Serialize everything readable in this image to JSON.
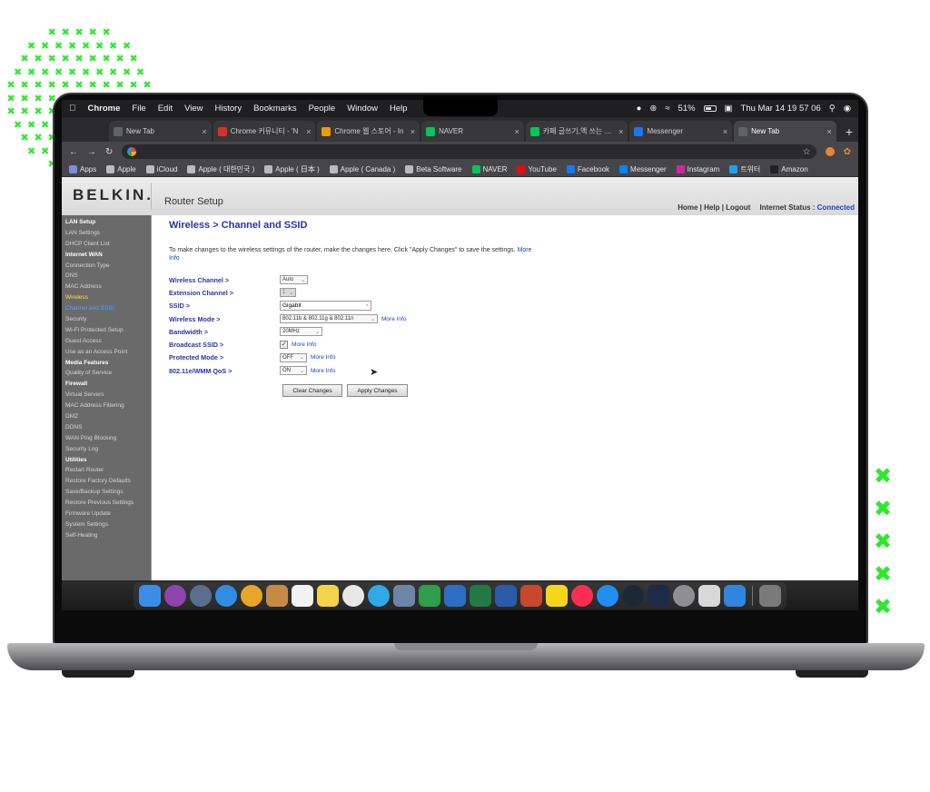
{
  "menubar": {
    "items": [
      "Chrome",
      "File",
      "Edit",
      "View",
      "History",
      "Bookmarks",
      "People",
      "Window",
      "Help"
    ],
    "battery": "51%",
    "datetime": "Thu Mar 14  19 57 06"
  },
  "tabs": [
    {
      "label": "New Tab",
      "color": "#5f6368",
      "active": false
    },
    {
      "label": "Chrome 커뮤니티 - 'N",
      "color": "#d93025",
      "active": false
    },
    {
      "label": "Chrome 웹 스토어 - In",
      "color": "#f29900",
      "active": false
    },
    {
      "label": "NAVER",
      "color": "#03c75a",
      "active": false
    },
    {
      "label": "카페 글쓰기,액 쓰는 사람",
      "color": "#03c75a",
      "active": false
    },
    {
      "label": "Messenger",
      "color": "#1877f2",
      "active": false
    },
    {
      "label": "New Tab",
      "color": "#5f6368",
      "active": true
    }
  ],
  "bookmarks": [
    {
      "label": "Apps",
      "color": "#7b8cde"
    },
    {
      "label": "Apple",
      "color": "#bbbbbb"
    },
    {
      "label": "iCloud",
      "color": "#bbbbbb"
    },
    {
      "label": "Apple ( 대한민국 )",
      "color": "#bbbbbb"
    },
    {
      "label": "Apple ( 日本 )",
      "color": "#bbbbbb"
    },
    {
      "label": "Apple ( Canada )",
      "color": "#bbbbbb"
    },
    {
      "label": "Beta Software",
      "color": "#bbbbbb"
    },
    {
      "label": "NAVER",
      "color": "#03c75a"
    },
    {
      "label": "YouTube",
      "color": "#ff0000"
    },
    {
      "label": "Facebook",
      "color": "#1877f2"
    },
    {
      "label": "Messenger",
      "color": "#0084ff"
    },
    {
      "label": "Instagram",
      "color": "#d6249f"
    },
    {
      "label": "트위터",
      "color": "#1da1f2"
    },
    {
      "label": "Amazon",
      "color": "#222222"
    }
  ],
  "router": {
    "brand": "BELKIN.",
    "setup": "Router Setup",
    "nav": {
      "home": "Home",
      "help": "Help",
      "logout": "Logout",
      "status_label": "Internet Status :",
      "status_value": "Connected"
    },
    "sidebar": [
      {
        "label": "LAN Setup",
        "kind": "head"
      },
      {
        "label": "LAN Settings",
        "kind": "item"
      },
      {
        "label": "DHCP Client List",
        "kind": "item"
      },
      {
        "label": "Internet WAN",
        "kind": "head"
      },
      {
        "label": "Connection Type",
        "kind": "item"
      },
      {
        "label": "DNS",
        "kind": "item"
      },
      {
        "label": "MAC Address",
        "kind": "item"
      },
      {
        "label": "Wireless",
        "kind": "cur"
      },
      {
        "label": "Channel and SSID",
        "kind": "sub"
      },
      {
        "label": "Security",
        "kind": "item"
      },
      {
        "label": "Wi-Fi Protected Setup",
        "kind": "item"
      },
      {
        "label": "Guest Access",
        "kind": "item"
      },
      {
        "label": "Use as an Access Point",
        "kind": "item"
      },
      {
        "label": "Media Features",
        "kind": "head"
      },
      {
        "label": "Quality of Service",
        "kind": "item"
      },
      {
        "label": "Firewall",
        "kind": "head"
      },
      {
        "label": "Virtual Servers",
        "kind": "item"
      },
      {
        "label": "MAC Address Filtering",
        "kind": "item"
      },
      {
        "label": "DMZ",
        "kind": "item"
      },
      {
        "label": "DDNS",
        "kind": "item"
      },
      {
        "label": "WAN Ping Blocking",
        "kind": "item"
      },
      {
        "label": "Security Log",
        "kind": "item"
      },
      {
        "label": "Utilities",
        "kind": "head"
      },
      {
        "label": "Restart Router",
        "kind": "item"
      },
      {
        "label": "Restore Factory Defaults",
        "kind": "item"
      },
      {
        "label": "Save/Backup Settings",
        "kind": "item"
      },
      {
        "label": "Restore Previous Settings",
        "kind": "item"
      },
      {
        "label": "Firmware Update",
        "kind": "item"
      },
      {
        "label": "System Settings",
        "kind": "item"
      },
      {
        "label": "Self-Healing",
        "kind": "item"
      }
    ],
    "title": "Wireless > Channel and SSID",
    "intro": "To make changes to the wireless settings of the router, make the changes here. Click \"Apply Changes\" to save the settings.",
    "more_info": "More Info",
    "fields": {
      "channel": {
        "label": "Wireless Channel >",
        "value": "Auto"
      },
      "ext_channel": {
        "label": "Extension Channel >",
        "value": "1"
      },
      "ssid": {
        "label": "SSID >",
        "value": "Gigabit"
      },
      "mode": {
        "label": "Wireless Mode >",
        "value": "802.11b & 802.11g & 802.11n",
        "more": "More Info"
      },
      "bandwidth": {
        "label": "Bandwidth >",
        "value": "20MHz"
      },
      "broadcast": {
        "label": "Broadcast SSID >",
        "checked": true,
        "more": "More Info"
      },
      "protected": {
        "label": "Protected Mode >",
        "value": "OFF",
        "more": "More Info"
      },
      "wmm": {
        "label": "802.11e/WMM QoS >",
        "value": "ON",
        "more": "More Info"
      }
    },
    "buttons": {
      "clear": "Clear Changes",
      "apply": "Apply Changes"
    }
  },
  "dock": [
    {
      "name": "finder-icon",
      "color": "#3b8ee8",
      "round": false
    },
    {
      "name": "siri-icon",
      "color": "#8e44ad",
      "round": true
    },
    {
      "name": "launchpad-icon",
      "color": "#5a6f8f",
      "round": true
    },
    {
      "name": "safari-icon",
      "color": "#2f8de4",
      "round": true
    },
    {
      "name": "chrome-icon",
      "color": "#e8a52b",
      "round": true
    },
    {
      "name": "contacts-icon",
      "color": "#c58a44",
      "round": false
    },
    {
      "name": "calendar-icon",
      "color": "#f2f2f2",
      "round": false
    },
    {
      "name": "notes-icon",
      "color": "#f4d24a",
      "round": false
    },
    {
      "name": "photos-icon",
      "color": "#e8e8e8",
      "round": true
    },
    {
      "name": "messages-icon",
      "color": "#2fa9e8",
      "round": true
    },
    {
      "name": "preview-icon",
      "color": "#6b86a8",
      "round": false
    },
    {
      "name": "numbers-icon",
      "color": "#2e9e4a",
      "round": false
    },
    {
      "name": "keynote-icon",
      "color": "#2d6ec5",
      "round": false
    },
    {
      "name": "excel-icon",
      "color": "#1f7a44",
      "round": false
    },
    {
      "name": "word-icon",
      "color": "#2a5ba8",
      "round": false
    },
    {
      "name": "powerpoint-icon",
      "color": "#c9472b",
      "round": false
    },
    {
      "name": "kakaotalk-icon",
      "color": "#f7d51d",
      "round": false
    },
    {
      "name": "music-icon",
      "color": "#fa2d55",
      "round": true
    },
    {
      "name": "appstore-icon",
      "color": "#1e8fef",
      "round": true
    },
    {
      "name": "steam-icon",
      "color": "#1b2838",
      "round": true
    },
    {
      "name": "topaz-icon",
      "color": "#1e2a4a",
      "round": false
    },
    {
      "name": "settings-icon",
      "color": "#8e8e93",
      "round": true
    },
    {
      "name": "screenshot-icon",
      "color": "#d8d8d8",
      "round": false
    },
    {
      "name": "downloads-icon",
      "color": "#2e86de",
      "round": false
    },
    {
      "name": "trash-icon",
      "color": "#7a7a7a",
      "round": false
    }
  ]
}
